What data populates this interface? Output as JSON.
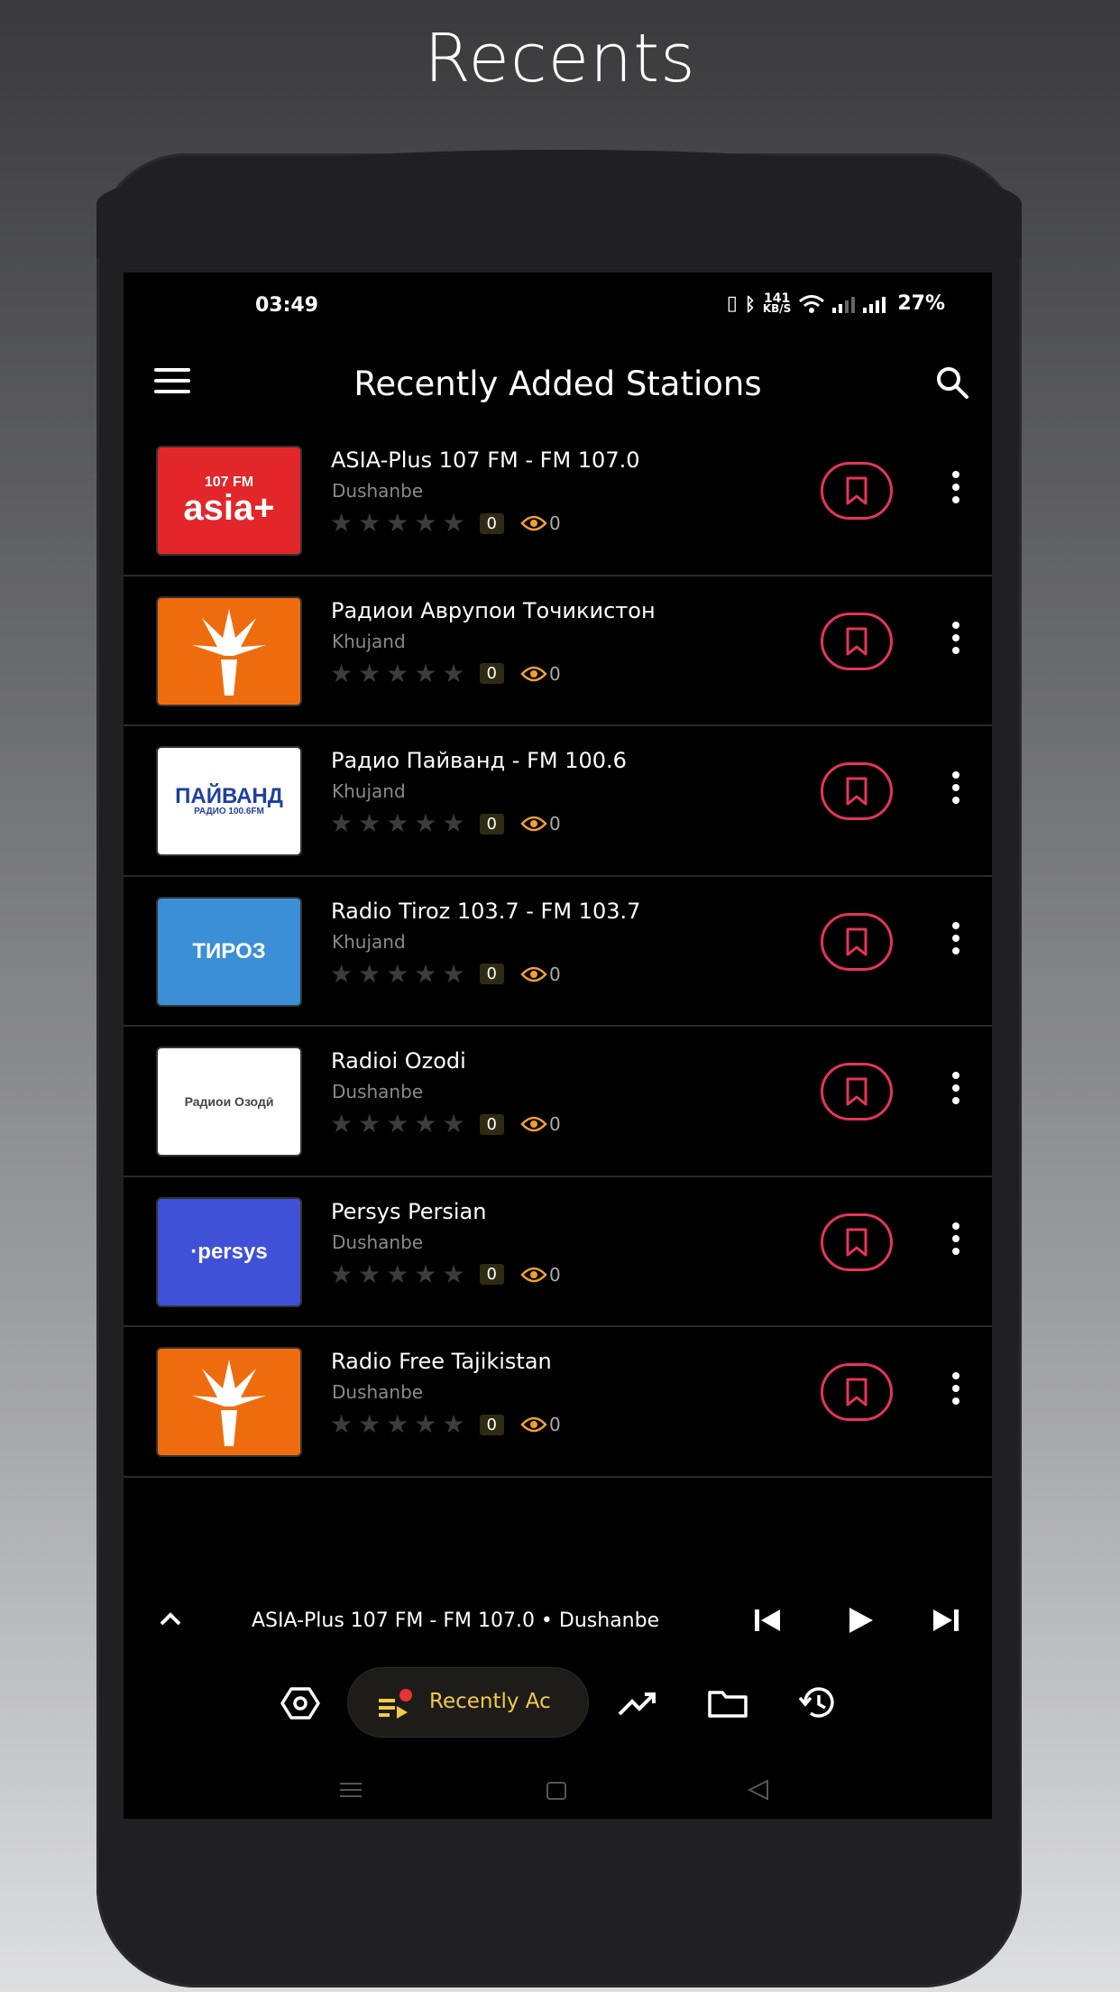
{
  "page": {
    "heading": "Recents"
  },
  "status_bar": {
    "time": "03:49",
    "net_speed_top": "141",
    "net_speed_unit": "KB/S",
    "battery": "27%"
  },
  "app_bar": {
    "title": "Recently Added Stations"
  },
  "stations": [
    {
      "name": "ASIA-Plus 107 FM - FM 107.0",
      "city": "Dushanbe",
      "rating_count": "0",
      "views": "0",
      "logo_bg": "#e2262a",
      "logo_text": "asia+",
      "logo_sub": "107 FM"
    },
    {
      "name": "Радиои Аврупои Точикистон",
      "city": "Khujand",
      "rating_count": "0",
      "views": "0",
      "logo_bg": "#ef6c0e"
    },
    {
      "name": "Радио Пайванд - FM 100.6",
      "city": "Khujand",
      "rating_count": "0",
      "views": "0",
      "logo_bg": "#ffffff",
      "logo_text": "ПАЙВАНД",
      "logo_sub": "РАДИО 100.6FM"
    },
    {
      "name": "Radio Tiroz 103.7 - FM 103.7",
      "city": "Khujand",
      "rating_count": "0",
      "views": "0",
      "logo_bg": "#3a8fd6",
      "logo_text": "ТИРОЗ"
    },
    {
      "name": "Radioi Ozodi",
      "city": "Dushanbe",
      "rating_count": "0",
      "views": "0",
      "logo_bg": "#ffffff",
      "logo_text": "Радиои Озодӣ"
    },
    {
      "name": "Persys Persian",
      "city": "Dushanbe",
      "rating_count": "0",
      "views": "0",
      "logo_bg": "#3f51d6",
      "logo_text": "·persys"
    },
    {
      "name": "Radio Free Tajikistan",
      "city": "Dushanbe",
      "rating_count": "0",
      "views": "0",
      "logo_bg": "#ef6c0e"
    }
  ],
  "player": {
    "now_playing": "ASIA-Plus 107 FM - FM 107.0 • Dushanbe"
  },
  "bottom_nav": {
    "active_label": "Recently Ac"
  },
  "colors": {
    "accent_red": "#e53558",
    "accent_yellow": "#f2c94c",
    "eye_orange": "#f0a030"
  }
}
